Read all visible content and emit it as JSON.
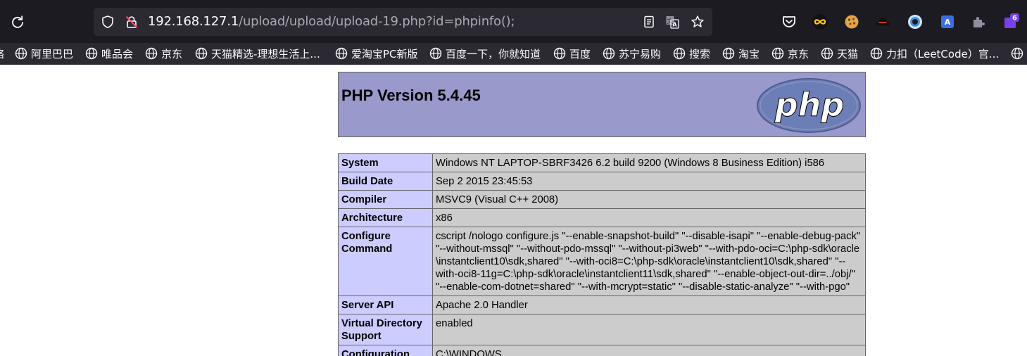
{
  "browser": {
    "url_host": "192.168.127.1",
    "url_path": "/upload/upload/upload-19.php?id=phpinfo();",
    "extension_badge": "6",
    "bookmarks": [
      {
        "label": "阿里巴巴"
      },
      {
        "label": "唯品会"
      },
      {
        "label": "京东"
      },
      {
        "label": "天猫精选-理想生活上..."
      },
      {
        "label": "爱淘宝PC新版"
      },
      {
        "label": "百度一下，你就知道"
      },
      {
        "label": "百度"
      },
      {
        "label": "苏宁易购"
      },
      {
        "label": "搜索"
      },
      {
        "label": "淘宝"
      },
      {
        "label": "京东"
      },
      {
        "label": "天猫"
      },
      {
        "label": "力扣（LeetCode）官..."
      }
    ]
  },
  "php": {
    "title": "PHP Version 5.4.45",
    "logo_text": "php",
    "rows": [
      {
        "key": "System",
        "value": "Windows NT LAPTOP-SBRF3426 6.2 build 9200 (Windows 8 Business Edition) i586"
      },
      {
        "key": "Build Date",
        "value": "Sep 2 2015 23:45:53"
      },
      {
        "key": "Compiler",
        "value": "MSVC9 (Visual C++ 2008)"
      },
      {
        "key": "Architecture",
        "value": "x86"
      },
      {
        "key": "Configure Command",
        "value": "cscript /nologo configure.js \"--enable-snapshot-build\" \"--disable-isapi\" \"--enable-debug-pack\" \"--without-mssql\" \"--without-pdo-mssql\" \"--without-pi3web\" \"--with-pdo-oci=C:\\php-sdk\\oracle \\instantclient10\\sdk,shared\" \"--with-oci8=C:\\php-sdk\\oracle\\instantclient10\\sdk,shared\" \"--with-oci8-11g=C:\\php-sdk\\oracle\\instantclient11\\sdk,shared\" \"--enable-object-out-dir=../obj/\" \"--enable-com-dotnet=shared\" \"--with-mcrypt=static\" \"--disable-static-analyze\" \"--with-pgo\""
      },
      {
        "key": "Server API",
        "value": "Apache 2.0 Handler"
      },
      {
        "key": "Virtual Directory Support",
        "value": "enabled"
      },
      {
        "key": "Configuration",
        "value": "C:\\WINDOWS"
      }
    ]
  }
}
